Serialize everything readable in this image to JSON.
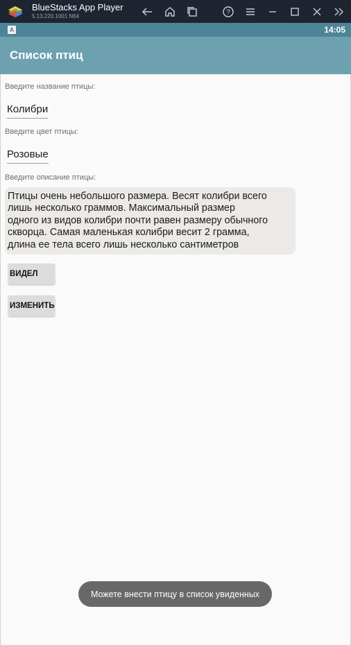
{
  "window": {
    "title": "BlueStacks App Player",
    "version": "5.13.220.1001 N64",
    "icons": [
      "back-icon",
      "home-icon",
      "multi-instance-icon",
      "help-icon",
      "menu-icon",
      "minimize-icon",
      "maximize-icon",
      "close-icon",
      "sidebar-toggle-icon"
    ]
  },
  "statusbar": {
    "notification": "A",
    "time": "14:05"
  },
  "actionbar": {
    "title": "Список птиц"
  },
  "form": {
    "name_label": "Введите название птицы:",
    "name_value": "Колибри",
    "color_label": "Введите цвет птицы:",
    "color_value": "Розовые",
    "desc_label": "Введите описание птицы:",
    "desc_lines": [
      "Птицы очень небольшого размера. Весят колибри всего",
      "лишь несколько граммов. Максимальный размер",
      "одного из видов колибри почти равен размеру обычного",
      "скворца. Самая маленькая колибри весит 2 грамма,",
      "длина ее тела всего лишь несколько сантиметров"
    ]
  },
  "buttons": {
    "seen_label": "ВИДЕЛ",
    "edit_label": "ИЗМЕНИТЬ"
  },
  "toast": {
    "text": "Можете внести птицу в список увиденных"
  },
  "colors": {
    "titlebar": "#1f2431",
    "statusbar": "#4d8497",
    "actionbar": "#6ea1b0",
    "toast": "#686868"
  }
}
